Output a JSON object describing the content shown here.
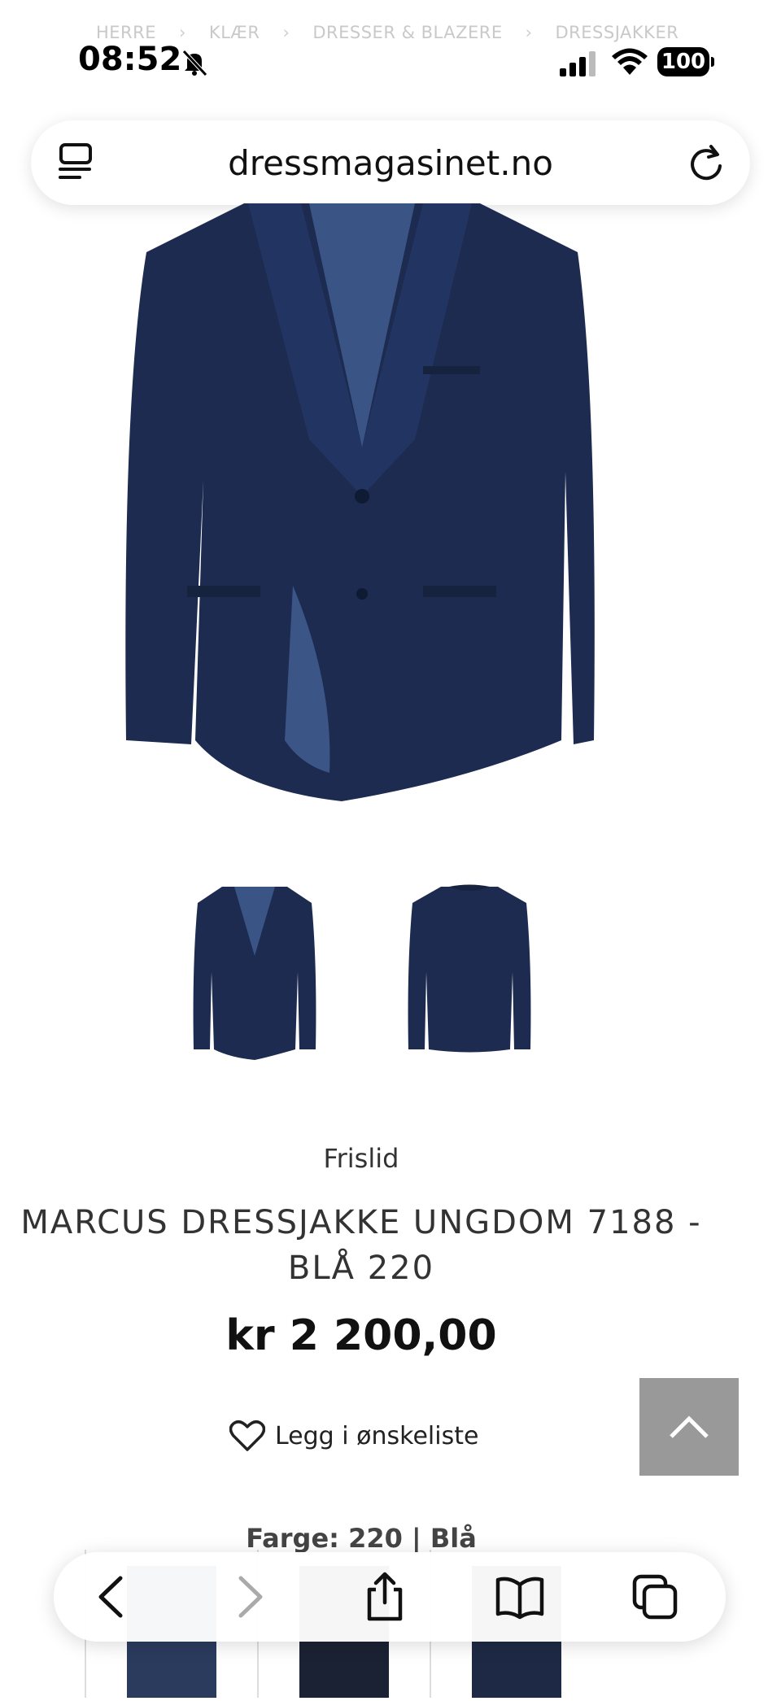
{
  "breadcrumb": [
    "HERRE",
    "KLÆR",
    "DRESSER & BLAZERE",
    "DRESSJAKKER"
  ],
  "breadcrumb_sep": "›",
  "status": {
    "time": "08:52",
    "battery": "100"
  },
  "url": "dressmagasinet.no",
  "product": {
    "brand": "Frislid",
    "title_line1": "MARCUS DRESSJAKKE UNGDOM 7188 -",
    "title_line2": "BLÅ 220",
    "price": "kr 2 200,00",
    "wishlist": "Legg i ønskeliste",
    "color_label": "Farge:",
    "color_value": "220 | Blå"
  },
  "colors": {
    "jacket": "#1c2b4f",
    "scroll_top_bg": "#999999"
  }
}
